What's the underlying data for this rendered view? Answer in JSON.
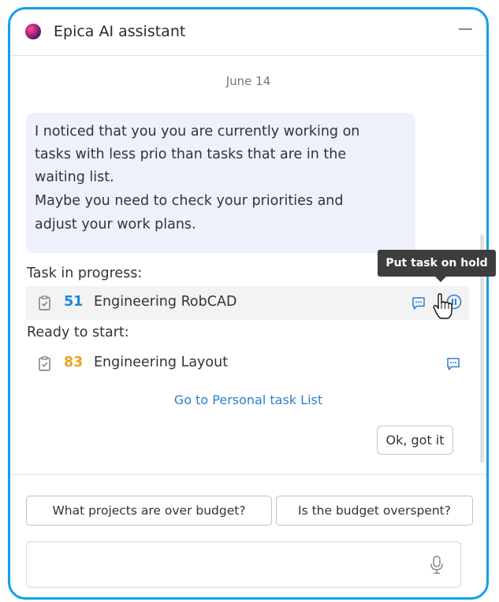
{
  "header": {
    "title": "Epica AI assistant",
    "logo_icon": "epica-logo-icon",
    "minimize_icon": "minimize-icon"
  },
  "conversation": {
    "date": "June 14",
    "message_lines": [
      "I noticed that you you are currently working on",
      "tasks with less prio than tasks that are in the",
      "waiting list.",
      "Maybe you need to check your priorities and",
      "adjust your work plans."
    ],
    "in_progress_label": "Task in progress:",
    "in_progress_task": {
      "number": "51",
      "name": "Engineering RobCAD",
      "number_color": "#1e88d8"
    },
    "ready_label": "Ready to start:",
    "ready_task": {
      "number": "83",
      "name": "Engineering Layout",
      "number_color": "#f0a020"
    },
    "tooltip": "Put task on hold",
    "link": "Go to Personal task List",
    "ok_button": "Ok, got it"
  },
  "suggestions": [
    "What projects are over budget?",
    "Is the budget overspent?"
  ],
  "input": {
    "placeholder": "",
    "value": "",
    "mic_icon": "microphone-icon"
  },
  "colors": {
    "frame": "#14a0e6",
    "bubble": "#eef1fb",
    "link": "#2d7fcf"
  }
}
